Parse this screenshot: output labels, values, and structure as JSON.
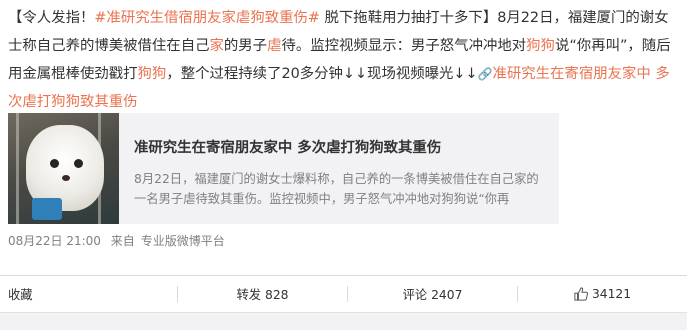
{
  "post": {
    "p1": "【令人发指！",
    "topic1": "#准研究生借宿朋友家虐狗致重伤#",
    "p2": " 脱下拖鞋用力抽打十多下】8月22日，福建厦门的谢女士称自己养的博美被借住在自己",
    "k1": "家",
    "p3": "的男子",
    "k2": "虐",
    "p4": "待。监控视频显示：男子怒气冲冲地对",
    "k3": "狗狗",
    "p5": "说“你再叫”，随后用金属棍棒使劲戳打",
    "k4": "狗狗",
    "p6": "，整个过程持续了20多分钟↓↓现场视频曝光↓↓",
    "link_icon": "🔗",
    "link_text": "准研究生在寄宿朋友家中 多次虐打狗狗致其重伤"
  },
  "card": {
    "title": "准研究生在寄宿朋友家中 多次虐打狗狗致其重伤",
    "desc": "8月22日，福建厦门的谢女士爆料称，自己养的一条博美被借住在自己家的一名男子虐待致其重伤。监控视频中，男子怒气冲冲地对狗狗说“你再"
  },
  "meta": {
    "time": "08月22日 21:00",
    "from_label": "来自",
    "source": "专业版微博平台"
  },
  "actions": {
    "favorite": "收藏",
    "repost": "转发 828",
    "comment": "评论 2407",
    "likes": "34121"
  },
  "colors": {
    "link": "#eb7350",
    "text": "#333333",
    "muted": "#808080",
    "card_bg": "#f2f2f5"
  }
}
